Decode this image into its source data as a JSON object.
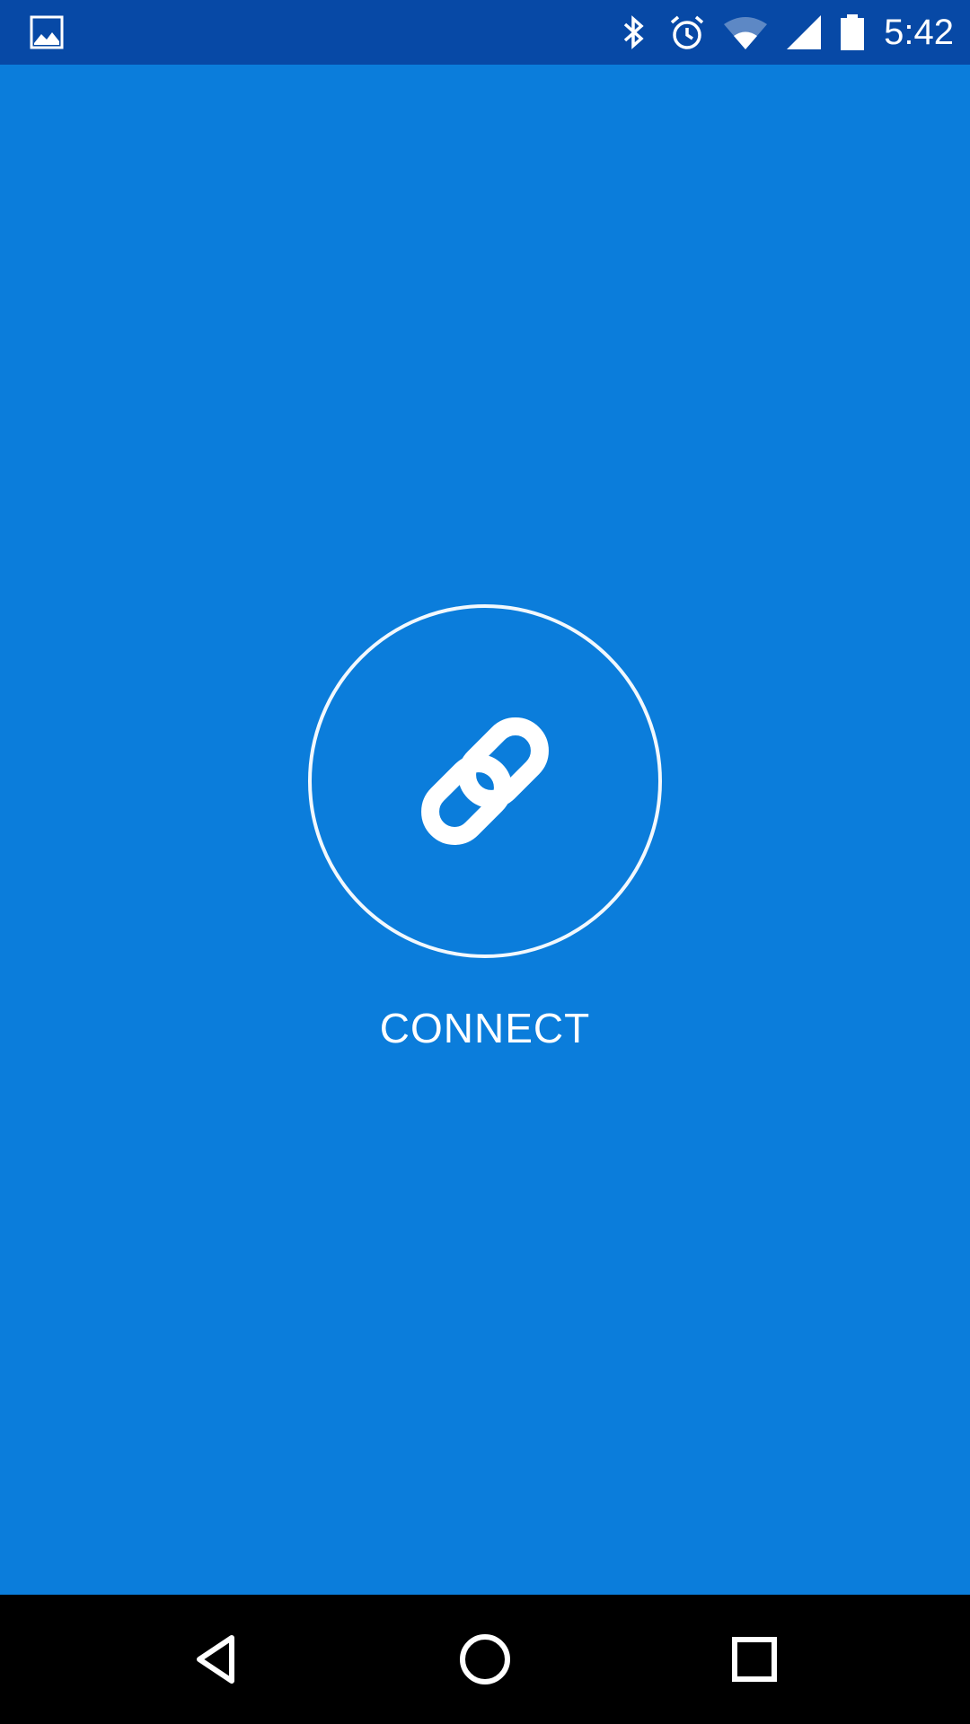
{
  "status_bar": {
    "time": "5:42",
    "icons": [
      "image-icon",
      "bluetooth-icon",
      "alarm-icon",
      "wifi-icon",
      "cell-signal-icon",
      "battery-icon"
    ]
  },
  "main": {
    "connect_label": "CONNECT",
    "connect_icon": "link-icon"
  },
  "nav_bar": {
    "icons": [
      "back-icon",
      "home-icon",
      "recents-icon"
    ]
  },
  "colors": {
    "status_bar_bg": "#0749A6",
    "app_bg": "#0B7DDB",
    "nav_bg": "#000000",
    "foreground": "#FFFFFF"
  }
}
